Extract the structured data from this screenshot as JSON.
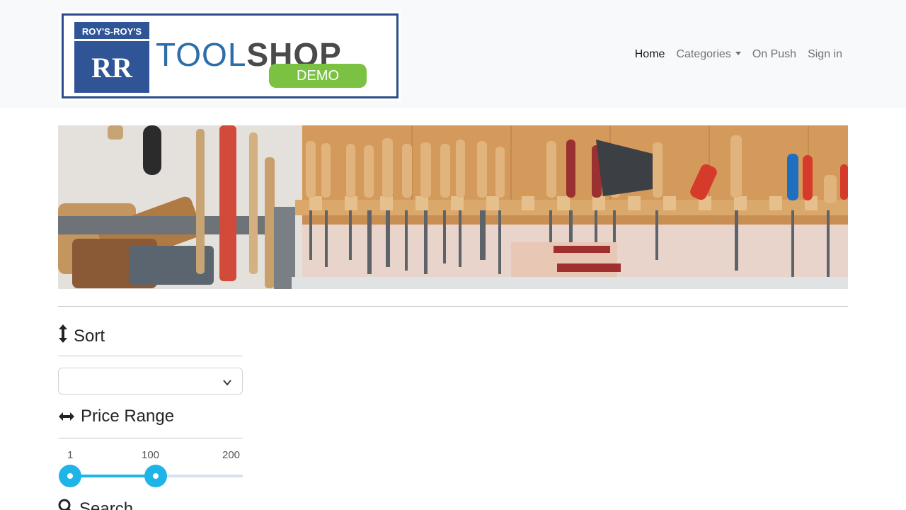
{
  "header": {
    "logo": {
      "badge_top": "ROY'S-ROY'S",
      "badge_bottom": "RR",
      "word_tool": "TOOL",
      "word_shop": "SHOP",
      "demo": "DEMO"
    },
    "nav": {
      "home": "Home",
      "categories": "Categories",
      "on_push": "On Push",
      "sign_in": "Sign in"
    }
  },
  "banner": {
    "icon": "workshop-tools-banner-image"
  },
  "sidebar": {
    "sort": {
      "title": "Sort",
      "icon": "sort-vertical-arrows-icon",
      "selected": ""
    },
    "price_range": {
      "title": "Price Range",
      "icon": "horizontal-arrows-icon",
      "min": "1",
      "max": "200",
      "current_min": 1,
      "current_max": 100,
      "current_max_label": "100"
    },
    "search": {
      "title": "Search",
      "icon": "search-icon"
    }
  },
  "colors": {
    "slider_accent": "#1fb4e8",
    "logo_blue": "#2f5597",
    "logo_green": "#7cc242"
  }
}
